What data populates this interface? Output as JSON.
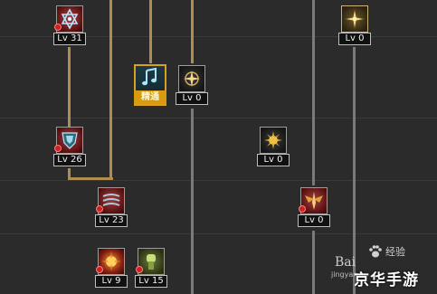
{
  "skills": [
    {
      "id": "s1",
      "level": "Lv 31",
      "icon": "hexagram-icon",
      "locked": true
    },
    {
      "id": "s2",
      "level": "Lv 0",
      "icon": "compass-star-icon",
      "locked": false
    },
    {
      "id": "s3",
      "level": "Lv 0",
      "icon": "starburst-icon",
      "locked": false
    },
    {
      "id": "s4",
      "level": "Lv 26",
      "icon": "shield-crest-icon",
      "locked": true
    },
    {
      "id": "s5",
      "level": "Lv 0",
      "icon": "gold-sun-icon",
      "locked": false
    },
    {
      "id": "s6",
      "level": "Lv 23",
      "icon": "whirlwind-icon",
      "locked": true
    },
    {
      "id": "s7",
      "level": "Lv 0",
      "icon": "winged-blade-icon",
      "locked": true
    },
    {
      "id": "s8",
      "level": "Lv 9",
      "icon": "fire-burst-icon",
      "locked": true
    },
    {
      "id": "s9",
      "level": "Lv 15",
      "icon": "fist-icon",
      "locked": true
    }
  ],
  "mastery": {
    "label": "精通",
    "icon": "music-note-icon"
  },
  "watermark": {
    "baidu": "Bai",
    "jingyan": "jingyan",
    "brand": "京华手游",
    "sub": "经验"
  }
}
